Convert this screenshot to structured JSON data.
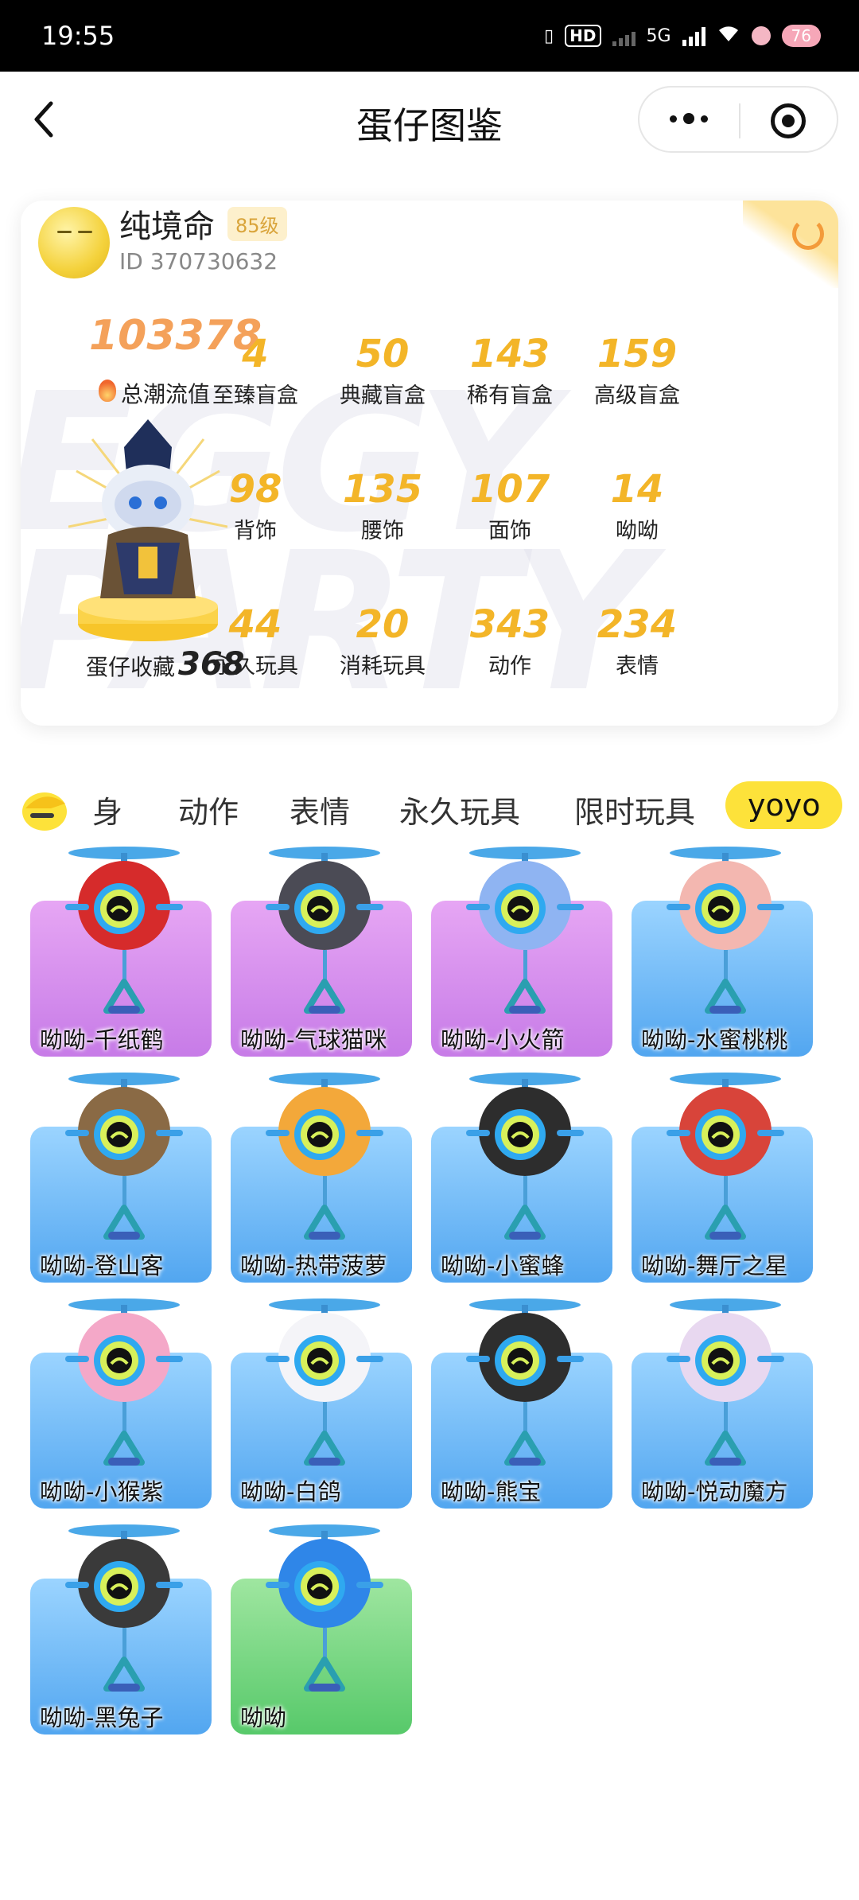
{
  "status": {
    "time": "19:55",
    "network": "5G",
    "battery": "76"
  },
  "nav": {
    "title": "蛋仔图鉴"
  },
  "profile": {
    "username": "纯境命",
    "level": "85级",
    "id": "ID 370730632",
    "trend_value": "103378",
    "trend_label": "总潮流值",
    "collection_label": "蛋仔收藏",
    "collection_count": "368"
  },
  "stats": [
    {
      "value": "4",
      "label": "至臻盲盒"
    },
    {
      "value": "50",
      "label": "典藏盲盒"
    },
    {
      "value": "143",
      "label": "稀有盲盒"
    },
    {
      "value": "159",
      "label": "高级盲盒"
    },
    {
      "value": "98",
      "label": "背饰"
    },
    {
      "value": "135",
      "label": "腰饰"
    },
    {
      "value": "107",
      "label": "面饰"
    },
    {
      "value": "14",
      "label": "呦呦"
    },
    {
      "value": "44",
      "label": "永久玩具"
    },
    {
      "value": "20",
      "label": "消耗玩具"
    },
    {
      "value": "343",
      "label": "动作"
    },
    {
      "value": "234",
      "label": "表情"
    }
  ],
  "tabs": [
    {
      "label": "身"
    },
    {
      "label": "动作"
    },
    {
      "label": "表情"
    },
    {
      "label": "永久玩具"
    },
    {
      "label": "限时玩具"
    },
    {
      "label": "yoyo"
    }
  ],
  "items": [
    {
      "name": "呦呦-千纸鹤",
      "bg": "purple",
      "color": "#d62b2b"
    },
    {
      "name": "呦呦-气球猫咪",
      "bg": "purple",
      "color": "#4b4b55"
    },
    {
      "name": "呦呦-小火箭",
      "bg": "purple",
      "color": "#8fb4f2"
    },
    {
      "name": "呦呦-水蜜桃桃",
      "bg": "blue",
      "color": "#f3b7b0"
    },
    {
      "name": "呦呦-登山客",
      "bg": "blue",
      "color": "#8a6a45"
    },
    {
      "name": "呦呦-热带菠萝",
      "bg": "blue",
      "color": "#f3a83a"
    },
    {
      "name": "呦呦-小蜜蜂",
      "bg": "blue",
      "color": "#2d2d2d"
    },
    {
      "name": "呦呦-舞厅之星",
      "bg": "blue",
      "color": "#d8443a"
    },
    {
      "name": "呦呦-小猴紫",
      "bg": "blue",
      "color": "#f4a8c8"
    },
    {
      "name": "呦呦-白鸽",
      "bg": "blue",
      "color": "#f4f4f8"
    },
    {
      "name": "呦呦-熊宝",
      "bg": "blue",
      "color": "#2e2e2e"
    },
    {
      "name": "呦呦-悦动魔方",
      "bg": "blue",
      "color": "#e8d8f0"
    },
    {
      "name": "呦呦-黑兔子",
      "bg": "blue",
      "color": "#3a3a3a"
    },
    {
      "name": "呦呦",
      "bg": "green",
      "color": "#2f86e8"
    }
  ]
}
